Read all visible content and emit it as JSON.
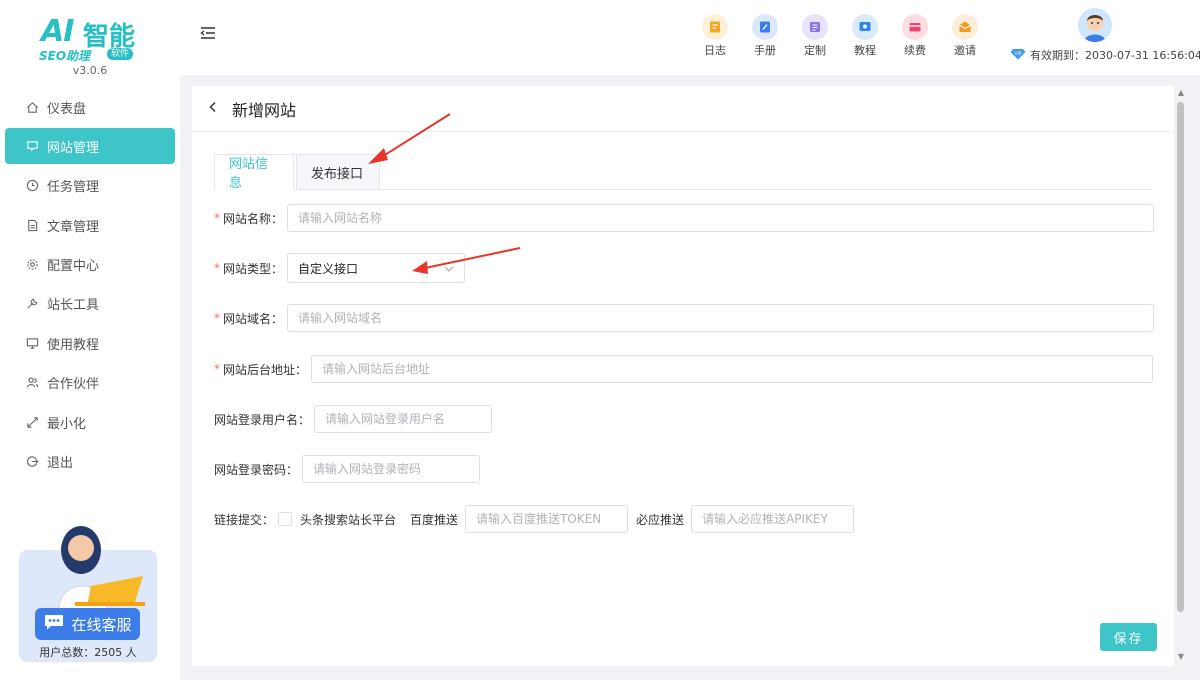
{
  "logo": {
    "ai": "AI",
    "zn": "智能",
    "seo": "SEO助理",
    "soft": "软件",
    "version": "v3.0.6"
  },
  "sidebar": {
    "items": [
      {
        "label": "仪表盘",
        "icon": "home-icon",
        "active": false
      },
      {
        "label": "网站管理",
        "icon": "website-icon",
        "active": true
      },
      {
        "label": "任务管理",
        "icon": "clock-icon",
        "active": false
      },
      {
        "label": "文章管理",
        "icon": "document-icon",
        "active": false
      },
      {
        "label": "配置中心",
        "icon": "gear-icon",
        "active": false
      },
      {
        "label": "站长工具",
        "icon": "wrench-icon",
        "active": false
      },
      {
        "label": "使用教程",
        "icon": "monitor-icon",
        "active": false
      },
      {
        "label": "合作伙伴",
        "icon": "partner-icon",
        "active": false
      },
      {
        "label": "最小化",
        "icon": "minimize-icon",
        "active": false
      },
      {
        "label": "退出",
        "icon": "logout-icon",
        "active": false
      }
    ],
    "support": {
      "button_label": "在线客服",
      "user_count": "用户总数：2505 人"
    }
  },
  "topbar": {
    "nav": [
      {
        "label": "日志",
        "icon": "log-icon",
        "color": "#f5a623",
        "bg": "#fdf0d8"
      },
      {
        "label": "手册",
        "icon": "manual-icon",
        "color": "#3d7de9",
        "bg": "#dce8fb"
      },
      {
        "label": "定制",
        "icon": "custom-icon",
        "color": "#8e72e6",
        "bg": "#e8e2fa"
      },
      {
        "label": "教程",
        "icon": "tutorial-icon",
        "color": "#2f86e8",
        "bg": "#d9eafb"
      },
      {
        "label": "续费",
        "icon": "renew-icon",
        "color": "#f0466e",
        "bg": "#fcdde4"
      },
      {
        "label": "邀请",
        "icon": "invite-icon",
        "color": "#f59a23",
        "bg": "#fdeed9"
      }
    ],
    "expire": "有效期到：2030-07-31 16:56:04"
  },
  "page": {
    "title": "新增网站",
    "tabs": [
      {
        "label": "网站信息",
        "active": true
      },
      {
        "label": "发布接口",
        "active": false
      }
    ],
    "form": {
      "site_name": {
        "label": "网站名称：",
        "placeholder": "请输入网站名称"
      },
      "site_type": {
        "label": "网站类型：",
        "value": "自定义接口"
      },
      "site_domain": {
        "label": "网站域名：",
        "placeholder": "请输入网站域名"
      },
      "admin_url": {
        "label": "网站后台地址：",
        "placeholder": "请输入网站后台地址"
      },
      "login_user": {
        "label": "网站登录用户名：",
        "placeholder": "请输入网站登录用户名"
      },
      "login_pass": {
        "label": "网站登录密码：",
        "placeholder": "请输入网站登录密码"
      },
      "link_submit": {
        "label": "链接提交：",
        "toutiao_label": "头条搜索站长平台",
        "baidu_label": "百度推送",
        "baidu_placeholder": "请输入百度推送TOKEN",
        "bing_label": "必应推送",
        "bing_placeholder": "请输入必应推送APIKEY"
      }
    },
    "save_label": "保存"
  },
  "colors": {
    "accent": "#3dc5c7",
    "required": "#f56c6c",
    "arrow": "#e8352a"
  }
}
